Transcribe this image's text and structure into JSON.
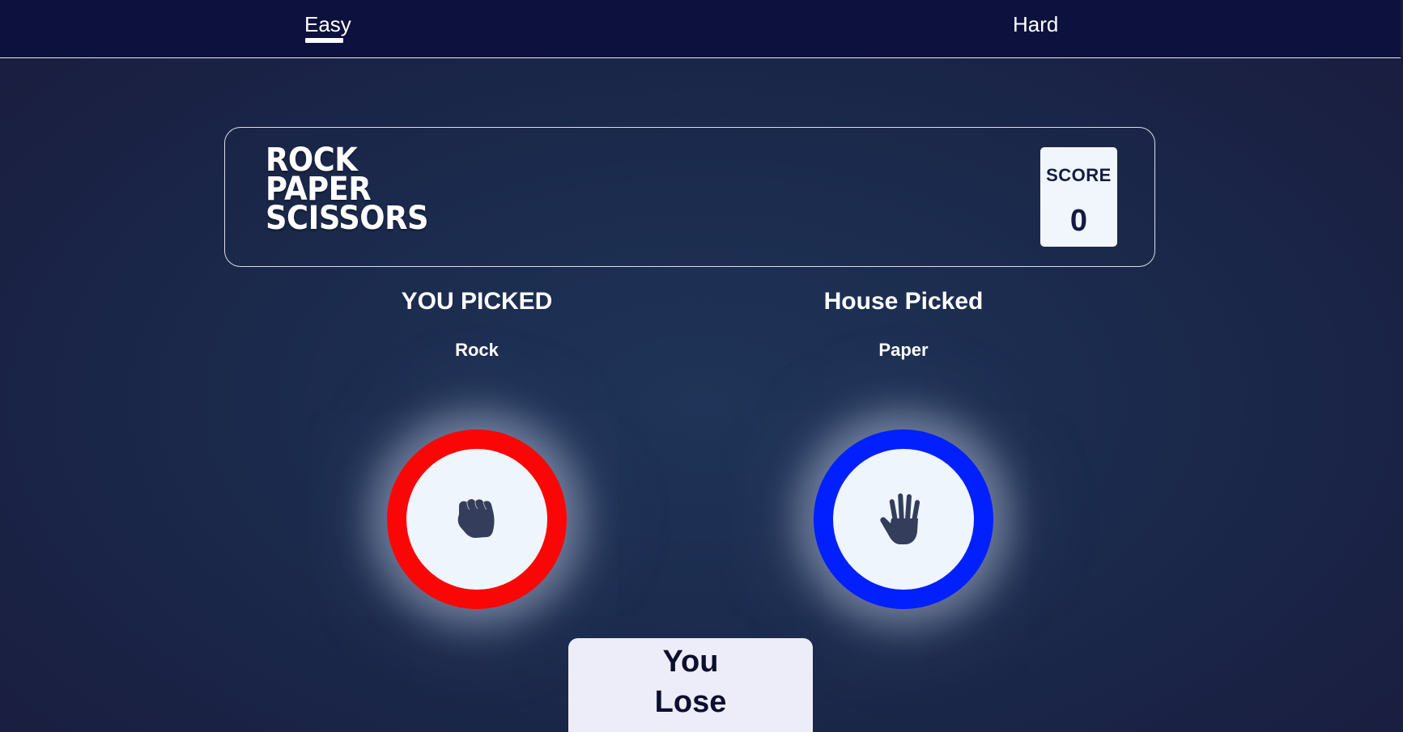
{
  "nav": {
    "tabs": [
      {
        "label": "Easy",
        "active": true
      },
      {
        "label": "Hard",
        "active": false
      }
    ]
  },
  "header": {
    "title_lines": [
      "ROCK",
      "PAPER",
      "SCISSORS"
    ],
    "score_label": "SCORE",
    "score_value": "0"
  },
  "player": {
    "heading": "YOU PICKED",
    "choice": "Rock",
    "icon": "fist-icon",
    "ring_color": "#fb0606"
  },
  "house": {
    "heading": "House Picked",
    "choice": "Paper",
    "icon": "open-hand-icon",
    "ring_color": "#0220fd"
  },
  "result": {
    "lines": [
      "You",
      "Lose"
    ]
  }
}
